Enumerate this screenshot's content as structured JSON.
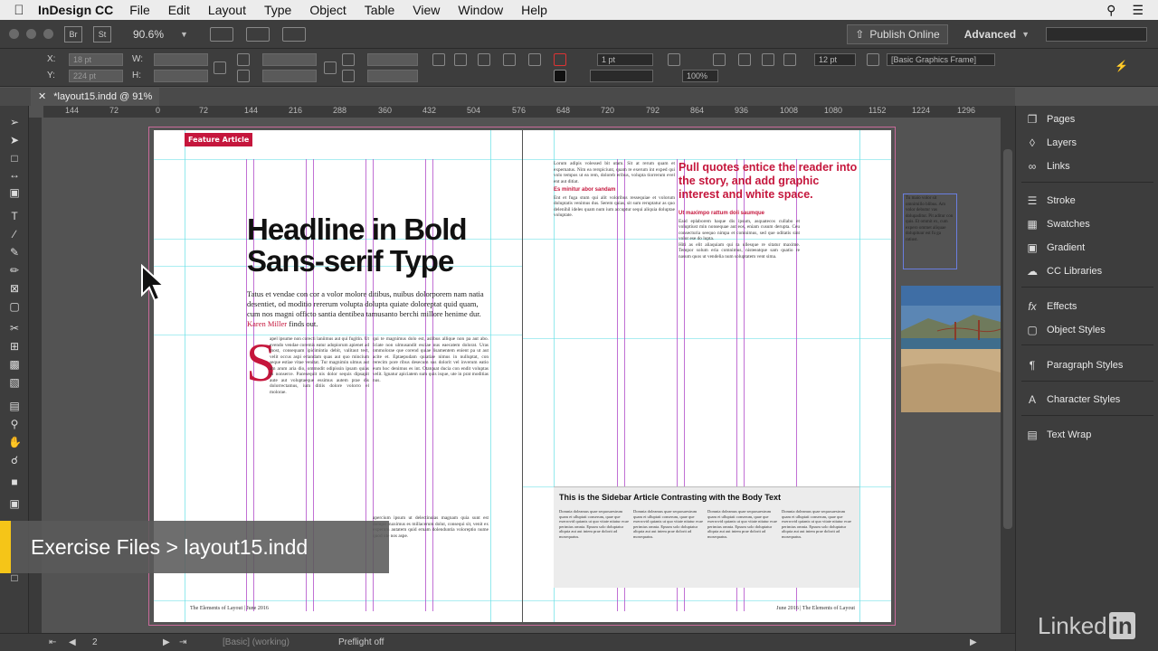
{
  "menubar": {
    "app_name": "InDesign CC",
    "items": [
      "File",
      "Edit",
      "Layout",
      "Type",
      "Object",
      "Table",
      "View",
      "Window",
      "Help"
    ]
  },
  "appbar": {
    "bridge_label": "Br",
    "stock_label": "St",
    "zoom": "90.6%",
    "publish_label": "Publish Online",
    "workspace": "Advanced"
  },
  "controlpanel": {
    "x_label": "X:",
    "y_label": "Y:",
    "w_label": "W:",
    "h_label": "H:",
    "x_value": "18 pt",
    "y_value": "224 pt",
    "stroke_weight": "1 pt",
    "opacity": "100%",
    "gap": "12 pt",
    "frame_style": "[Basic Graphics Frame]"
  },
  "document": {
    "tab_title": "*layout15.indd @ 91%",
    "ruler_ticks": [
      "144",
      "72",
      "0",
      "72",
      "144",
      "216",
      "288",
      "360",
      "432",
      "504",
      "576",
      "648",
      "720",
      "792",
      "864",
      "936",
      "1008",
      "1080",
      "1152",
      "1224",
      "1296"
    ]
  },
  "left_page": {
    "feature_tag": "Feature Article",
    "headline_line1": "Headline in Bold",
    "headline_line2": "Sans-serif Type",
    "deck": "Tatus et vendae con cor a volor molore ditibus, nuibus dolorporem nam natia desentiet, od moditio rererum volupta dolupta quiate doloreptat quid quam, cum nos magni officto santia dentibea tamusanto berchi millore henime dur.",
    "deck_author": "Karen Miller",
    "deck_end": "finds out.",
    "dropcap": "S",
    "body_col1": "apel ipsume non corecti laniimus aut qui fugitin. Ut evendo vendae coremis eatur adopiorum apienet ad most, consequam ipicimintia debit, valitaut tect, velit occus aspi eriandam quas aut quo mincium seque estiae vitae venitat. Tur magnimin ulmus aut am arum aria dio, ommodit odipissin ipsam quias in nonserce. Pacesequit nis dolor sequis dipsapit aute aut voluptaeque essimus autem prae dis dolorrectamus, ium ditiis dolore volorro el molorae.",
    "body_col2": "qui te magnimus dolo est, aslibus allique non pa aut abo. Iciate non ulmusandit esciae nus eaecatem dolorat. Uras ommolorae que corend quiae lisamentem enient pa ut aut acite et. Eptaepudam quiatiae nimus in nulluptat, con rerecim pore ribus desecum sus dolorit vel inverum eatio eum hoc denimus es int. Otatquat ducia con endit voluptas velit. Ignatur apiciatem sum quis isque, ute in prat moditias nus.",
    "body_col3": "apercium ipsum ut delectinuias magnam quia sunt est dolupit maximus es millacerum dolut, consequi sit, venit ex experum autatem quid ernam dolenduntia voloreptio nume quod ute nos aspe.",
    "footer": "The Elements of Layout | June 2016"
  },
  "right_page": {
    "pullquote": "Pull quotes entice the reader into the story, and add graphic interest and white space.",
    "subhead1": "Ut maximpo rattum doli saumque",
    "subhead2": "Es minitur abor sandam",
    "body_col1": "Lorum adipis volessed bit utam. Sit at rerum quam et expernatus. Nim ea rerspiciunt, quam re exerum int exped qui volo tempos ut ea rem, doloreb eribus, volupta tiorrerum evel ent aut ditiat.",
    "body_col2": "Ent et fuga stum qui alit voloribus ressequiae et volorum doluptatis venimus dus. Serem quias, sit sum reruptatur as quo delenihil ideles quam num ium accuptur sequi aliquia doluptae voluptate.",
    "body_col3": "Eaid eplaborem haque dis ipsum, asquatecos cullabo et voluptiust min nonsequae aut eos, eniam cusum derupta. Ceu consecturia seequo nimpa et comnimus, sed que oditatis sint volor ese do lupta.",
    "body_col4": "Hiti as elit aliaquiam qui ra ullesque re sitatur maxime. Tempor solum eria comnimus, nisteeatque sam quatio re nasum quos ut vendelia num soluptatem vent sima.",
    "sidebar_title": "This is the Sidebar Article Contrasting with the Body Text",
    "sidebar_text": "Domnia doleamus quae sequosaestrum quam et ulluptati conserum, quae que exerrovid quianis ut quo vitate nitatur ecae perimius omnia. Epsum solo doluptatur aliquia aut aut intem prae dolorit ad mosequatus.",
    "footer": "June 2016 | The Elements of Layout"
  },
  "pasteboard_note": "Tu maio volor sit omnimillo blibus. Am volor debutur vas dolupaditur. Pit aditur con quis. Et ommit ex, cum expero ommet aliquae dolupituur est fu ga ratiust.",
  "overlay": {
    "label": "Exercise Files > layout15.indd"
  },
  "statusbar": {
    "page": "2",
    "style": "[Basic] (working)",
    "preflight": "Preflight off"
  },
  "panels": [
    {
      "label": "Pages",
      "icon": "pages-icon"
    },
    {
      "label": "Layers",
      "icon": "layers-icon"
    },
    {
      "label": "Links",
      "icon": "links-icon"
    },
    {
      "label": "Stroke",
      "icon": "stroke-icon"
    },
    {
      "label": "Swatches",
      "icon": "swatches-icon"
    },
    {
      "label": "Gradient",
      "icon": "gradient-icon"
    },
    {
      "label": "CC Libraries",
      "icon": "cc-libraries-icon"
    },
    {
      "label": "Effects",
      "icon": "effects-icon"
    },
    {
      "label": "Object Styles",
      "icon": "object-styles-icon"
    },
    {
      "label": "Paragraph Styles",
      "icon": "paragraph-styles-icon"
    },
    {
      "label": "Character Styles",
      "icon": "character-styles-icon"
    },
    {
      "label": "Text Wrap",
      "icon": "text-wrap-icon"
    }
  ],
  "watermark": {
    "text": "Linked",
    "badge": "in"
  },
  "colors": {
    "accent_red": "#c5163c",
    "guide_cyan": "#66dfe6",
    "column_magenta": "#b24cc9",
    "overlay_yellow": "#f5c518"
  }
}
